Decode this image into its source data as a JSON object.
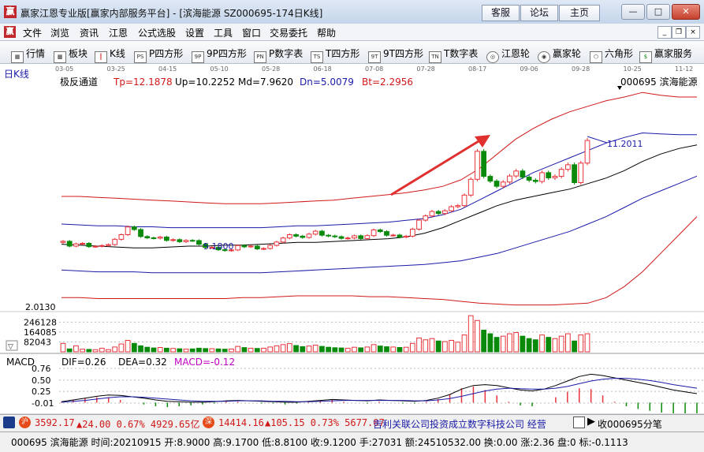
{
  "window": {
    "title": "赢家江恩专业版[赢家内部服务平台] - [滨海能源  SZ000695-174日K线]",
    "logo_text": "赢",
    "top_buttons": [
      "客服",
      "论坛",
      "主页"
    ],
    "controls": {
      "minimize": "—",
      "maximize": "□",
      "close": "✕"
    }
  },
  "menu": {
    "items": [
      "文件",
      "浏览",
      "资讯",
      "江恩",
      "公式选股",
      "设置",
      "工具",
      "窗口",
      "交易委托",
      "帮助"
    ],
    "mdi": {
      "minimize": "_",
      "restore": "❐",
      "close": "×"
    }
  },
  "toolbar": {
    "items": [
      {
        "label": "行情",
        "icon": "quote-grid-icon",
        "glyph": "▦"
      },
      {
        "label": "板块",
        "icon": "sector-grid-icon",
        "glyph": "▩"
      },
      {
        "label": "K线",
        "icon": "candlestick-icon",
        "glyph": "┃"
      },
      {
        "label": "P四方形",
        "icon": "p-square-icon",
        "glyph": "PS"
      },
      {
        "label": "9P四方形",
        "icon": "9p-square-icon",
        "glyph": "9P"
      },
      {
        "label": "P数字表",
        "icon": "p-number-table-icon",
        "glyph": "PN"
      },
      {
        "label": "T四方形",
        "icon": "t-square-icon",
        "glyph": "TS"
      },
      {
        "label": "9T四方形",
        "icon": "9t-square-icon",
        "glyph": "9T"
      },
      {
        "label": "T数字表",
        "icon": "t-number-table-icon",
        "glyph": "TN"
      },
      {
        "label": "江恩轮",
        "icon": "gann-wheel-icon",
        "glyph": "◎"
      },
      {
        "label": "赢家轮",
        "icon": "winner-wheel-icon",
        "glyph": "◉"
      },
      {
        "label": "六角形",
        "icon": "hexagon-icon",
        "glyph": "⬡"
      },
      {
        "label": "赢家服务",
        "icon": "service-dollar-icon",
        "glyph": "$"
      }
    ]
  },
  "chart_header": {
    "period": "日K线",
    "x_dates": [
      "03-05",
      "03-25",
      "04-15",
      "05-10",
      "05-28",
      "06-18",
      "07-08",
      "07-28",
      "08-17",
      "09-06",
      "09-28",
      "10-25",
      "11-12"
    ],
    "indicator": "极反通道",
    "tp": "Tp=12.1878",
    "up": "Up=10.2252",
    "md": "Md=7.9620",
    "dn": "Dn=5.0079",
    "bt": "Bt=2.2956",
    "stock": "000695  滨海能源"
  },
  "colors": {
    "up": "#e8333b",
    "down": "#0a8a0a",
    "band_outer": "#d01818",
    "band_mid": "#1a1aa8",
    "ma": "#000000",
    "arrow": "#e03030"
  },
  "annotations": {
    "high_label": "11.2011",
    "low_label": "5.1800",
    "price_axis_low": "2.0130"
  },
  "volume": {
    "ticks": [
      "246128",
      "164085",
      "82043"
    ],
    "toggle": "▽"
  },
  "macd": {
    "name": "MACD",
    "dif": "DIF=0.26",
    "dea": "DEA=0.32",
    "macd": "MACD=-0.12",
    "ticks": [
      "0.76",
      "0.50",
      "0.25",
      "-0.01"
    ]
  },
  "status_bar": {
    "index1_badge": "沪",
    "index1_value": "3592.17",
    "index1_change": "▲24.00 0.67% 4929.65亿",
    "index2_badge": "深",
    "index2_value": "14414.16",
    "index2_change": "▲105.15 0.73% 5677.07",
    "ticker": "吉利关联公司投资成立数字科技公司 经营",
    "watch": "收000695分笔"
  },
  "info_bar": {
    "text": "000695 滨海能源 时间:20210915 开:8.9000 高:9.1700 低:8.8100 收:9.1200 手:27031 额:24510532.00 换:0.00 涨:2.36 盘:0 标:-0.1113"
  },
  "chart_data": {
    "type": "candlestick",
    "title": "日K线",
    "indicator": "极反通道",
    "stock": "000695 滨海能源",
    "x_labels": [
      "03-05",
      "03-25",
      "04-15",
      "05-10",
      "05-28",
      "06-18",
      "07-08",
      "07-28",
      "08-17",
      "09-06",
      "09-28",
      "10-25",
      "11-12"
    ],
    "price_close": [
      5.66,
      5.4,
      5.52,
      5.55,
      5.37,
      5.39,
      5.43,
      5.48,
      5.77,
      6.02,
      6.44,
      6.3,
      5.92,
      5.85,
      5.83,
      5.89,
      5.71,
      5.75,
      5.64,
      5.71,
      5.7,
      5.5,
      5.33,
      5.33,
      5.2,
      5.16,
      5.19,
      5.43,
      5.36,
      5.4,
      5.25,
      5.27,
      5.44,
      5.62,
      5.84,
      6.02,
      5.94,
      5.87,
      6.05,
      6.21,
      5.99,
      5.95,
      5.91,
      5.82,
      5.84,
      5.96,
      5.81,
      5.97,
      6.28,
      6.19,
      5.99,
      6.0,
      5.89,
      5.94,
      6.32,
      6.81,
      7.04,
      7.28,
      7.17,
      7.32,
      7.54,
      7.6,
      8.17,
      9.03,
      10.55,
      9.19,
      8.93,
      8.65,
      8.88,
      9.21,
      9.48,
      9.15,
      8.98,
      8.91,
      9.39,
      9.11,
      9.19,
      9.57,
      9.82,
      8.85,
      9.91,
      11.14
    ],
    "volume_max_tick": 246128,
    "volume_ticks": [
      246128,
      164085,
      82043
    ],
    "volume": [
      70000,
      24000,
      50000,
      22000,
      20000,
      18000,
      30000,
      18000,
      40000,
      65000,
      95000,
      70000,
      50000,
      38000,
      32000,
      36000,
      30000,
      28000,
      25000,
      22000,
      24000,
      30000,
      27000,
      26000,
      24000,
      22000,
      23000,
      45000,
      35000,
      30000,
      28000,
      30000,
      40000,
      50000,
      60000,
      68000,
      52000,
      43000,
      48000,
      55000,
      45000,
      38000,
      34000,
      32000,
      30000,
      38000,
      33000,
      40000,
      60000,
      48000,
      42000,
      40000,
      36000,
      38000,
      70000,
      115000,
      100000,
      110000,
      90000,
      85000,
      95000,
      80000,
      140000,
      300000,
      260000,
      180000,
      150000,
      120000,
      130000,
      150000,
      160000,
      130000,
      110000,
      100000,
      140000,
      120000,
      110000,
      130000,
      150000,
      90000,
      140000,
      150000
    ],
    "bands": {
      "upper": [
        8.1,
        8.1,
        8.05,
        8.0,
        7.95,
        7.9,
        7.85,
        7.8,
        7.75,
        7.7,
        7.7,
        7.7,
        7.75,
        7.8,
        7.85,
        7.9,
        8.0,
        8.1,
        8.2,
        8.3,
        8.45,
        8.65,
        9.0,
        9.6,
        10.4,
        11.2,
        11.8,
        12.3,
        12.7,
        13.0,
        13.3,
        13.5,
        13.75,
        13.6,
        13.5,
        13.5
      ],
      "mid_upper": [
        6.6,
        6.55,
        6.5,
        6.5,
        6.45,
        6.45,
        6.4,
        6.4,
        6.4,
        6.4,
        6.4,
        6.4,
        6.45,
        6.5,
        6.5,
        6.55,
        6.6,
        6.65,
        6.7,
        6.8,
        6.9,
        7.1,
        7.4,
        7.9,
        8.4,
        8.9,
        9.4,
        9.8,
        10.2,
        10.6,
        11.0,
        11.3,
        11.55,
        11.5,
        11.45,
        11.45
      ],
      "mid": [
        5.5,
        5.45,
        5.4,
        5.35,
        5.3,
        5.3,
        5.35,
        5.4,
        5.4,
        5.45,
        5.45,
        5.5,
        5.55,
        5.6,
        5.6,
        5.65,
        5.7,
        5.75,
        5.8,
        5.9,
        6.1,
        6.4,
        6.8,
        7.2,
        7.6,
        7.9,
        8.1,
        8.3,
        8.5,
        8.8,
        9.1,
        9.5,
        10.0,
        10.4,
        10.7,
        10.9
      ],
      "lower": [
        4.1,
        4.05,
        4.0,
        4.0,
        4.0,
        3.95,
        3.95,
        3.95,
        3.95,
        3.95,
        3.95,
        3.95,
        4.0,
        4.05,
        4.1,
        4.15,
        4.2,
        4.25,
        4.3,
        4.35,
        4.4,
        4.5,
        4.6,
        4.8,
        5.0,
        5.3,
        5.6,
        5.9,
        6.2,
        6.6,
        7.0,
        7.5,
        8.0,
        8.4,
        8.8,
        9.2
      ],
      "bottom": [
        2.6,
        2.6,
        2.55,
        2.55,
        2.55,
        2.55,
        2.55,
        2.55,
        2.55,
        2.55,
        2.6,
        2.6,
        2.65,
        2.7,
        2.7,
        2.7,
        2.7,
        2.65,
        2.65,
        2.6,
        2.55,
        2.5,
        2.4,
        2.3,
        2.25,
        2.2,
        2.2,
        2.2,
        2.25,
        2.3,
        2.6,
        3.2,
        4.0,
        5.0,
        6.0,
        7.0
      ]
    },
    "macd_ticks": [
      0.76,
      0.5,
      0.25,
      -0.01
    ],
    "macd_dif": [
      0.02,
      0.06,
      0.1,
      0.14,
      0.17,
      0.16,
      0.13,
      0.1,
      0.06,
      0.03,
      0.02,
      0.01,
      0.01,
      0.02,
      0.04,
      0.05,
      0.04,
      0.03,
      0.02,
      0.01,
      0.01,
      0.03,
      0.05,
      0.07,
      0.06,
      0.05,
      0.04,
      0.06,
      0.05,
      0.04,
      0.03,
      0.05,
      0.1,
      0.18,
      0.3,
      0.38,
      0.4,
      0.38,
      0.33,
      0.28,
      0.26,
      0.3,
      0.38,
      0.48,
      0.58,
      0.63,
      0.6,
      0.55,
      0.5,
      0.45,
      0.4,
      0.34,
      0.28,
      0.24,
      0.2
    ],
    "macd_dea": [
      0.01,
      0.03,
      0.05,
      0.08,
      0.11,
      0.13,
      0.13,
      0.12,
      0.1,
      0.08,
      0.06,
      0.04,
      0.03,
      0.03,
      0.03,
      0.04,
      0.04,
      0.04,
      0.03,
      0.03,
      0.02,
      0.02,
      0.03,
      0.04,
      0.05,
      0.05,
      0.05,
      0.05,
      0.05,
      0.05,
      0.04,
      0.04,
      0.06,
      0.09,
      0.14,
      0.2,
      0.26,
      0.3,
      0.32,
      0.31,
      0.3,
      0.3,
      0.32,
      0.36,
      0.42,
      0.48,
      0.52,
      0.54,
      0.54,
      0.52,
      0.49,
      0.45,
      0.4,
      0.36,
      0.32
    ],
    "macd_range": [
      -0.01,
      0.76
    ]
  }
}
